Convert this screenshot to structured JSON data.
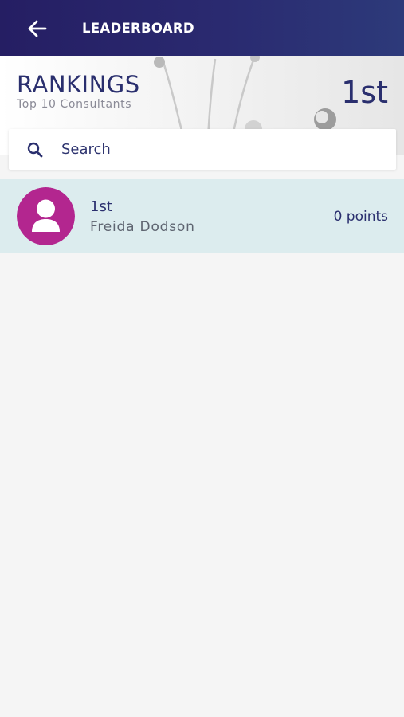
{
  "appbar": {
    "title": "LEADERBOARD",
    "back_icon": "arrow-left-icon"
  },
  "hero": {
    "title": "RANKINGS",
    "subtitle": "Top 10 Consultants",
    "user_rank": "1st"
  },
  "search": {
    "placeholder": "Search",
    "value": "",
    "icon": "search-icon"
  },
  "leaderboard": {
    "entries": [
      {
        "rank": "1st",
        "name": "Freida Dodson",
        "points": "0 points",
        "avatar_icon": "user-silhouette-icon"
      }
    ]
  },
  "colors": {
    "appbar": "#251e63",
    "primary_text": "#2a2f6e",
    "avatar_bg": "#b3268f",
    "highlight_row": "#dcecee",
    "background": "#f5f5f5"
  }
}
